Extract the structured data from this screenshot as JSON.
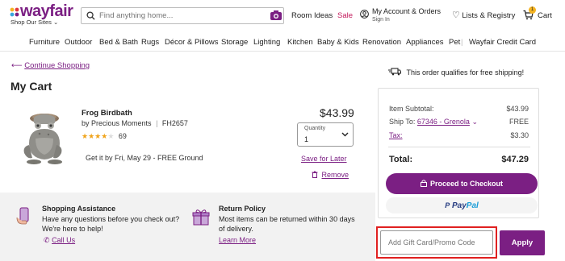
{
  "header": {
    "logo": "wayfair",
    "shop_sites": "Shop Our Sites",
    "search_placeholder": "Find anything home...",
    "room_ideas": "Room Ideas",
    "sale": "Sale",
    "account": "My Account & Orders",
    "sign_in": "Sign In",
    "lists": "Lists & Registry",
    "cart": "Cart",
    "cart_count": "1"
  },
  "nav": [
    "Furniture",
    "Outdoor",
    "Bed & Bath",
    "Rugs",
    "Décor & Pillows",
    "Storage",
    "Lighting",
    "Kitchen",
    "Baby & Kids",
    "Renovation",
    "Appliances",
    "Pet",
    "Wayfair Credit Card"
  ],
  "cart": {
    "continue": "Continue Shopping",
    "title": "My Cart",
    "item": {
      "name": "Frog Birdbath",
      "brand_line": "by Precious Moments",
      "sku": "FH2657",
      "rating_count": "69",
      "rating": 4.5,
      "delivery": "Get it by Fri, May 29 - FREE Ground",
      "price": "$43.99",
      "qty_label": "Quantity",
      "qty_value": "1",
      "save_later": "Save for Later",
      "remove": "Remove"
    }
  },
  "assist": {
    "shopping_title": "Shopping Assistance",
    "shopping_text1": "Have any questions before you check out?",
    "shopping_text2": "We're here to help!",
    "call_us": "Call Us",
    "return_title": "Return Policy",
    "return_text1": "Most items can be returned within 30 days",
    "return_text2": "of delivery.",
    "learn_more": "Learn More"
  },
  "summary": {
    "free_shipping": "This order qualifies for free shipping!",
    "subtotal_label": "Item Subtotal:",
    "subtotal": "$43.99",
    "ship_to_label": "Ship To:",
    "ship_to_value": "67346 - Grenola",
    "ship_cost": "FREE",
    "tax_label": "Tax:",
    "tax": "$3.30",
    "total_label": "Total:",
    "total": "$47.29",
    "checkout": "Proceed to Checkout",
    "paypal_p": "Pay",
    "paypal_pal": "Pal"
  },
  "promo": {
    "placeholder": "Add Gift Card/Promo Code",
    "apply": "Apply"
  },
  "colors": {
    "brand": "#7b1f83",
    "sale": "#c2185b",
    "highlight": "#e02020"
  }
}
